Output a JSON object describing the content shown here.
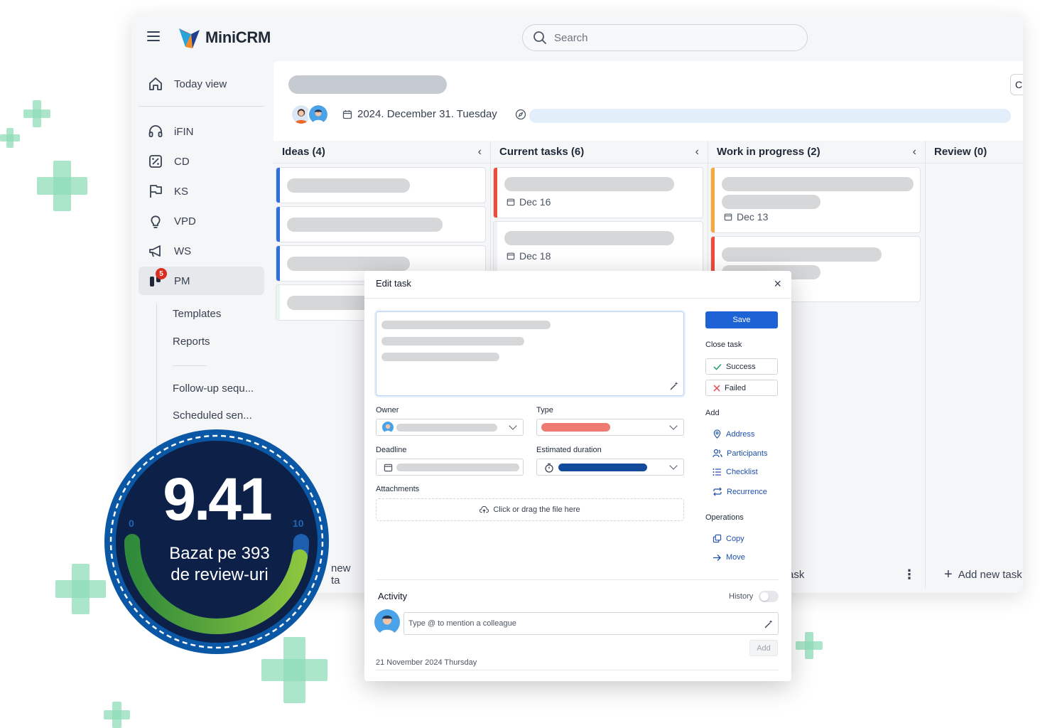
{
  "app": {
    "brand": "MiniCRM"
  },
  "search": {
    "placeholder": "Search"
  },
  "sidebar": {
    "items": [
      {
        "label": "Today view",
        "icon": "home-icon"
      },
      {
        "label": "iFIN",
        "icon": "headset-icon"
      },
      {
        "label": "CD",
        "icon": "percent-icon"
      },
      {
        "label": "KS",
        "icon": "flag-icon"
      },
      {
        "label": "VPD",
        "icon": "lightbulb-icon"
      },
      {
        "label": "WS",
        "icon": "megaphone-icon"
      },
      {
        "label": "PM",
        "icon": "board-icon",
        "badge": "5",
        "active": true
      }
    ],
    "sub_items": [
      "Templates",
      "Reports",
      "Follow-up sequ...",
      "Scheduled sen..."
    ]
  },
  "header": {
    "date": "2024. December 31. Tuesday",
    "button_label": "C"
  },
  "board": {
    "columns": [
      {
        "title": "Ideas (4)"
      },
      {
        "title": "Current tasks (6)"
      },
      {
        "title": "Work in progress (2)"
      },
      {
        "title": "Review (0)"
      }
    ],
    "due_dates": [
      "Dec 16",
      "Dec 18",
      "Dec 13"
    ],
    "footer": {
      "add_partial_1": "new ta",
      "add_partial_2": "ask",
      "add_new_task": "Add new task"
    }
  },
  "modal": {
    "title": "Edit task",
    "owner_label": "Owner",
    "type_label": "Type",
    "deadline_label": "Deadline",
    "duration_label": "Estimated duration",
    "attachments_label": "Attachments",
    "dropzone_text": "Click or drag the file here",
    "save": "Save",
    "close_task_label": "Close task",
    "success": "Success",
    "failed": "Failed",
    "add_label": "Add",
    "add_links": [
      "Address",
      "Participants",
      "Checklist",
      "Recurrence"
    ],
    "operations_label": "Operations",
    "operations": [
      "Copy",
      "Move"
    ],
    "activity_label": "Activity",
    "history_label": "History",
    "comment_placeholder": "Type @ to mention a colleague",
    "add_button": "Add",
    "activity_date": "21 November 2024 Thursday"
  },
  "rating": {
    "score": "9.41",
    "line1": "Bazat pe 393",
    "line2": "de review-uri",
    "scale_min": "0",
    "scale_max": "10",
    "value_fraction": 0.941
  },
  "colors": {
    "accent_blue": "#1e63d6",
    "stripe_blue": "#2f6fe0",
    "stripe_red": "#ef4a3c",
    "stripe_orange": "#f6a93b",
    "badge_navy": "#0c1f4a",
    "badge_green": "#7cc242"
  }
}
